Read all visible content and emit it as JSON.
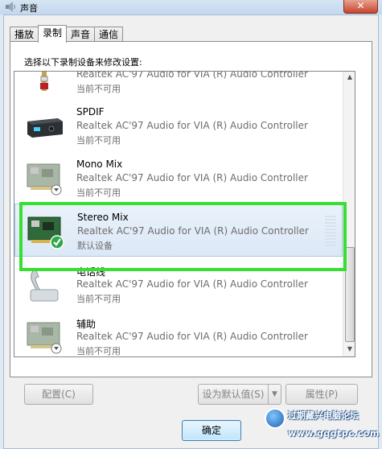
{
  "window": {
    "title": "声音",
    "close_glyph": "✕"
  },
  "tabs": [
    {
      "label": "播放",
      "active": false
    },
    {
      "label": "录制",
      "active": true
    },
    {
      "label": "声音",
      "active": false
    },
    {
      "label": "通信",
      "active": false
    }
  ],
  "panel": {
    "instruction": "选择以下录制设备来修改设置:"
  },
  "devices": [
    {
      "name": "",
      "driver": "Realtek AC'97 Audio for VIA (R) Audio Controller",
      "status": "当前不可用",
      "icon": "line-in-jack-icon"
    },
    {
      "name": "SPDIF",
      "driver": "Realtek AC'97 Audio for VIA (R) Audio Controller",
      "status": "当前不可用",
      "icon": "spdif-device-icon"
    },
    {
      "name": "Mono Mix",
      "driver": "Realtek AC'97 Audio for VIA (R) Audio Controller",
      "status": "当前不可用",
      "icon": "sound-card-disabled-icon"
    },
    {
      "name": "Stereo Mix",
      "driver": "Realtek AC'97 Audio for VIA (R) Audio Controller",
      "status": "默认设备",
      "icon": "sound-card-default-icon",
      "selected": true
    },
    {
      "name": "电话线",
      "driver": "Realtek AC'97 Audio for VIA (R) Audio Controller",
      "status": "当前不可用",
      "icon": "telephone-icon"
    },
    {
      "name": "辅助",
      "driver": "Realtek AC'97 Audio for VIA (R) Audio Controller",
      "status": "当前不可用",
      "icon": "sound-card-disabled-icon"
    }
  ],
  "buttons": {
    "configure": "配置(C)",
    "set_default": "设为默认值(S)",
    "properties": "属性(P)",
    "ok": "确定",
    "split_arrow": "▼"
  },
  "watermark": {
    "name": "过期藏兴电脑论坛",
    "url": "www.gqgtpc.com"
  },
  "colors": {
    "highlight": "#35e030",
    "title_bar": "#c4d8ee",
    "close_button": "#c7432d"
  }
}
